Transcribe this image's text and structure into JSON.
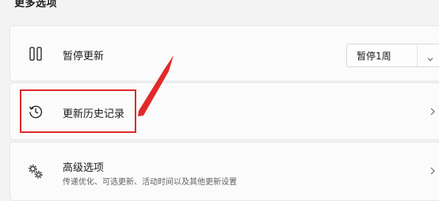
{
  "section": {
    "header": "更多选项"
  },
  "pause": {
    "icon": "pause-icon",
    "title": "暂停更新",
    "dropdown_value": "暂停1周",
    "dropdown_icon": "chevron-down-icon"
  },
  "history": {
    "icon": "history-icon",
    "title": "更新历史记录",
    "chevron_icon": "chevron-right-icon"
  },
  "advanced": {
    "icon": "gears-icon",
    "title": "高级选项",
    "subtitle": "传递优化、可选更新、活动时间以及其他更新设置",
    "chevron_icon": "chevron-right-icon"
  },
  "annotation": {
    "color": "#e02a2a"
  }
}
